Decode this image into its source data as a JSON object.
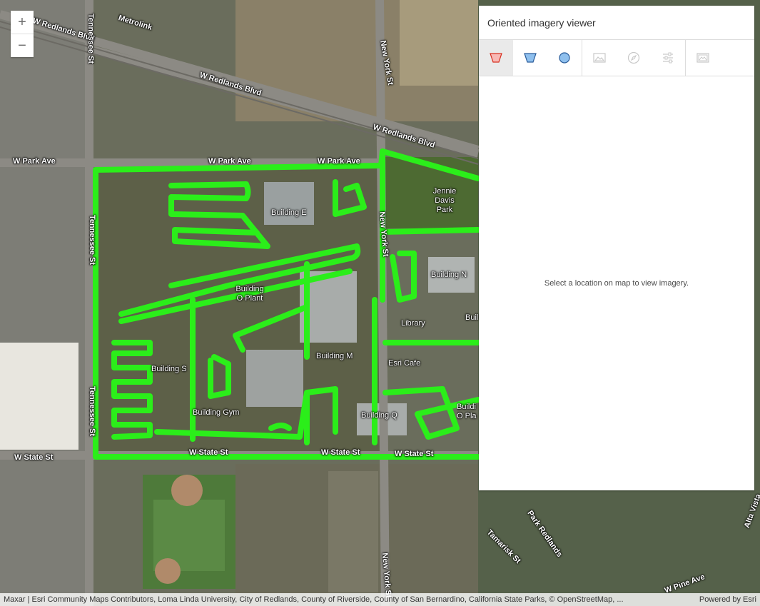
{
  "map": {
    "road_labels": [
      "W Redlands Blvd",
      "W Redlands Blvd",
      "W Redlands Blvd",
      "Metrolink",
      "W Park Ave",
      "W Park Ave",
      "W Park Ave",
      "W State St",
      "W State St",
      "W State St",
      "W State St",
      "Tennessee St",
      "Tennessee St",
      "Tennessee St",
      "New York St",
      "New York St",
      "New York St",
      "Park Redlands",
      "Tamarisk St",
      "W Pine Ave",
      "Alta Vista"
    ],
    "place_labels": [
      "Building E",
      "Building O Plant",
      "Building N",
      "Library",
      "Building M",
      "Esri Cafe",
      "Building S",
      "Building Gym",
      "Building Q",
      "Buildi O Pla",
      "Buil"
    ],
    "park_label": "Jennie Davis Park"
  },
  "zoom": {
    "in_label": "+",
    "out_label": "−"
  },
  "panel": {
    "title": "Oriented imagery viewer",
    "message": "Select a location on map to view imagery."
  },
  "toolbar": {
    "icons": [
      "footprint-icon",
      "camera-footprint-icon",
      "coverage-circle-icon",
      "image-enhance-icon",
      "compass-icon",
      "settings-sliders-icon",
      "gallery-icon"
    ]
  },
  "attribution": {
    "text": "Maxar | Esri Community Maps Contributors, Loma Linda University, City of Redlands, County of Riverside, County of San Bernardino, California State Parks, © OpenStreetMap, ...",
    "powered": "Powered by Esri"
  },
  "colors": {
    "trail": "#2bee1a",
    "active_tool_fill": "#f8b9b5",
    "active_tool_stroke": "#d83020",
    "tool_blue": "#4a90d9"
  }
}
